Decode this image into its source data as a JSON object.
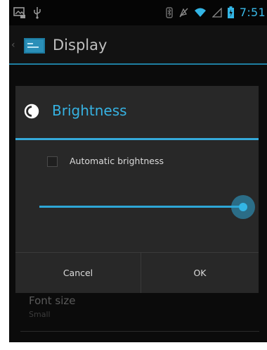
{
  "status_bar": {
    "time": "7:51",
    "icons": [
      "screenshot-icon",
      "usb-icon",
      "bluetooth-icon",
      "silent-icon",
      "wifi-icon",
      "signal-icon",
      "battery-icon"
    ]
  },
  "action_bar": {
    "title": "Display",
    "icon": "display-settings-icon"
  },
  "background_list": {
    "font_size_label": "Font size",
    "font_size_value": "Small"
  },
  "dialog": {
    "title": "Brightness",
    "title_icon": "brightness-icon",
    "automatic_label": "Automatic brightness",
    "automatic_checked": false,
    "brightness_level": 0.97,
    "cancel_label": "Cancel",
    "ok_label": "OK"
  },
  "colors": {
    "accent": "#33b5e5",
    "background": "#0b0b0b",
    "dialog": "#282828"
  }
}
